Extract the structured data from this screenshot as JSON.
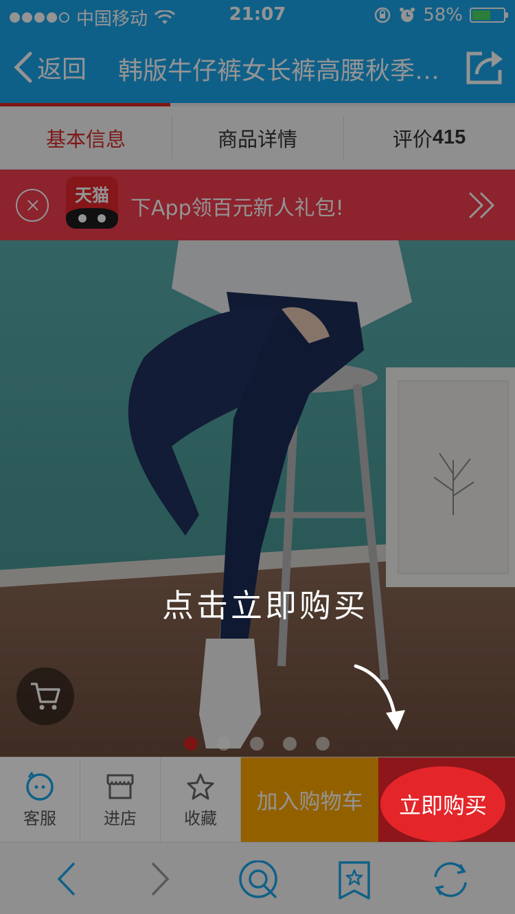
{
  "status_bar": {
    "carrier": "中国移动",
    "time": "21:07",
    "battery": "58%",
    "battery_level": 0.58
  },
  "nav": {
    "back_label": "返回",
    "title": "韩版牛仔裤女长裤高腰秋季新款"
  },
  "tabs": [
    {
      "label": "基本信息"
    },
    {
      "label": "商品详情"
    },
    {
      "label": "评价",
      "count": "415"
    }
  ],
  "tab_progress": 0.33,
  "promo": {
    "logo_text": "天猫",
    "text": "下App领百元新人礼包!"
  },
  "carousel": {
    "count": 5,
    "active": 0
  },
  "actions": {
    "service": "客服",
    "store": "进店",
    "favorite": "收藏",
    "add_to_cart": "加入购物车",
    "buy_now": "立即购买"
  },
  "overlay": {
    "hint": "点击立即购买",
    "highlight_label": "立即购买"
  },
  "colors": {
    "nav_blue": "#1aa6ea",
    "promo_red": "#f23d4f",
    "add_cart_orange": "#fea600",
    "buy_red": "#f1262b"
  },
  "icons": [
    "wifi-icon",
    "lock-rotation-icon",
    "alarm-icon",
    "share-icon",
    "close-circle-icon",
    "double-chevron-right-icon",
    "cart-icon",
    "chat-face-icon",
    "store-icon",
    "star-icon",
    "back-arrow-icon",
    "forward-arrow-icon",
    "home-q-icon",
    "bookmark-star-icon",
    "refresh-icon"
  ]
}
